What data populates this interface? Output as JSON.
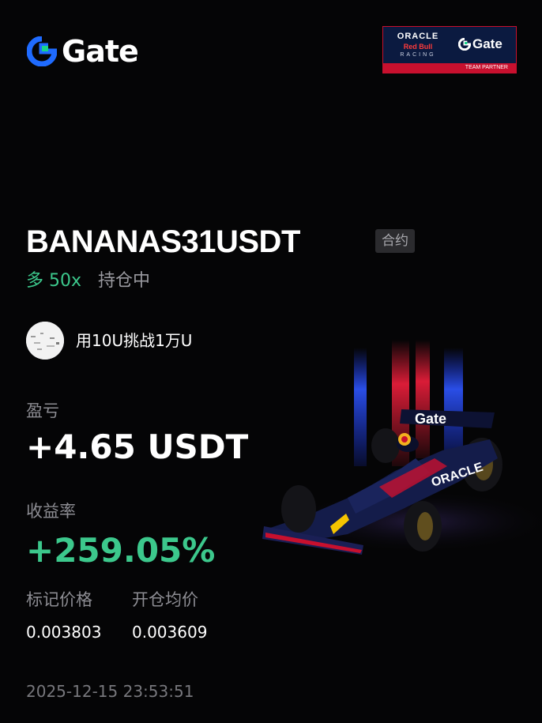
{
  "brand": {
    "logo_text": "Gate",
    "accent_color": "#1f6bff",
    "logo_icon": "gate-g-icon"
  },
  "partner_badge": {
    "line1": "ORACLE",
    "line2": "Red Bull",
    "line3": "RACING",
    "gate_text": "Gate",
    "strip_text": "TEAM PARTNER"
  },
  "trade": {
    "symbol": "BANANAS31USDT",
    "contract_tag": "合约",
    "side": "多 50x",
    "side_color": "#3cc88c",
    "status": "持仓中"
  },
  "user": {
    "avatar_icon": "avatar-icon",
    "nickname": "用10U挑战1万U"
  },
  "pnl": {
    "label": "盈亏",
    "value": "+4.65 USDT"
  },
  "roi": {
    "label": "收益率",
    "value": "+259.05%"
  },
  "prices": {
    "mark_label": "标记价格",
    "mark_value": "0.003803",
    "entry_label": "开仓均价",
    "entry_value": "0.003609"
  },
  "timestamp": "2025-12-15 23:53:51",
  "illustration": {
    "icon": "f1-race-car-image",
    "wing_text": "Gate",
    "sidepod_text": "ORACLE"
  }
}
